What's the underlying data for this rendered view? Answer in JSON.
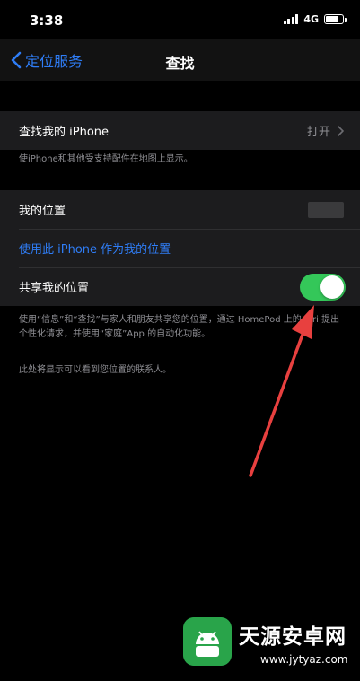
{
  "status_bar": {
    "time": "3:38",
    "network": "4G"
  },
  "nav": {
    "back_label": "定位服务",
    "title": "查找"
  },
  "find_iphone": {
    "label": "查找我的 iPhone",
    "value": "打开",
    "footnote": "使iPhone和其他受支持配件在地图上显示。"
  },
  "location": {
    "my_location_label": "我的位置",
    "use_iphone_link": "使用此 iPhone 作为我的位置",
    "share_label": "共享我的位置",
    "share_enabled": true
  },
  "share_footnote": "使用“信息”和“查找”与家人和朋友共享您的位置，通过 HomePod 上的 Siri 提出个性化请求，并使用“家庭”App 的自动化功能。",
  "contacts_note": "此处将显示可以看到您位置的联系人。",
  "watermark": {
    "title": "天源安卓网",
    "url": "www.jytyaz.com"
  },
  "colors": {
    "accent": "#2f7df6",
    "toggle_on": "#34c759",
    "annotation_arrow": "#e8403f"
  }
}
